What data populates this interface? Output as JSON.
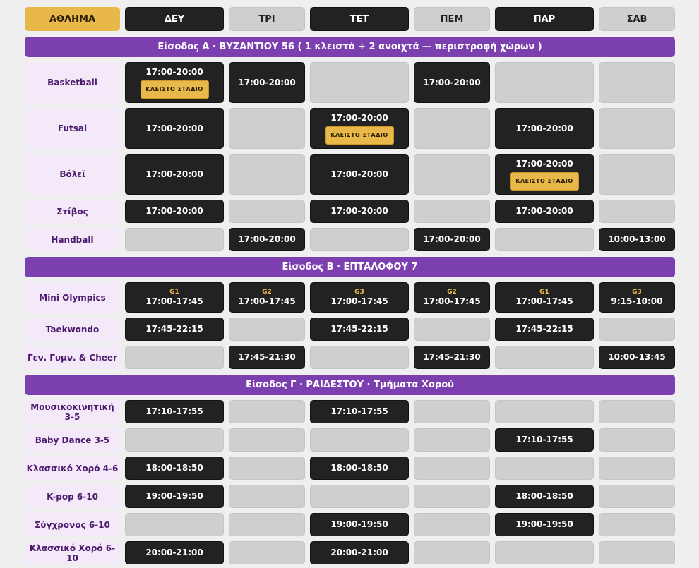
{
  "header": {
    "sport_label": "ΑΘΛΗΜΑ",
    "days": [
      "ΔΕΥ",
      "ΤΡΙ",
      "ΤΕΤ",
      "ΠΕΜ",
      "ΠΑΡ",
      "ΣΑΒ"
    ],
    "active_days": [
      0,
      2,
      4
    ]
  },
  "closed_label": "ΚΛΕΙΣΤΟ ΣΤΑΔΙΟ",
  "sections": [
    {
      "title": "Είσοδος Α · ΒΥΖΑΝΤΙΟΥ 56  ( 1 κλειστό + 2 ανοιχτά — περιστροφή χώρων )",
      "rows": [
        {
          "sport": "Basketball",
          "cells": [
            {
              "time": "17:00-20:00",
              "closed": true
            },
            {
              "time": "17:00-20:00"
            },
            null,
            {
              "time": "17:00-20:00"
            },
            null,
            null
          ]
        },
        {
          "sport": "Futsal",
          "cells": [
            {
              "time": "17:00-20:00"
            },
            null,
            {
              "time": "17:00-20:00",
              "closed": true
            },
            null,
            {
              "time": "17:00-20:00"
            },
            null
          ]
        },
        {
          "sport": "Βόλεϊ",
          "cells": [
            {
              "time": "17:00-20:00"
            },
            null,
            {
              "time": "17:00-20:00"
            },
            null,
            {
              "time": "17:00-20:00",
              "closed": true
            },
            null
          ]
        },
        {
          "sport": "Στίβος",
          "cells": [
            {
              "time": "17:00-20:00"
            },
            null,
            {
              "time": "17:00-20:00"
            },
            null,
            {
              "time": "17:00-20:00"
            },
            null
          ]
        },
        {
          "sport": "Handball",
          "cells": [
            null,
            {
              "time": "17:00-20:00"
            },
            null,
            {
              "time": "17:00-20:00"
            },
            null,
            {
              "time": "10:00-13:00"
            }
          ]
        }
      ]
    },
    {
      "title": "Είσοδος Β · ΕΠΤΑΛΟΦΟΥ 7",
      "rows": [
        {
          "sport": "Mini Olympics",
          "cells": [
            {
              "group": "G1",
              "time": "17:00-17:45"
            },
            {
              "group": "G2",
              "time": "17:00-17:45"
            },
            {
              "group": "G3",
              "time": "17:00-17:45"
            },
            {
              "group": "G2",
              "time": "17:00-17:45"
            },
            {
              "group": "G1",
              "time": "17:00-17:45"
            },
            {
              "group": "G3",
              "time": "9:15-10:00"
            }
          ]
        },
        {
          "sport": "Taekwondo",
          "cells": [
            {
              "time": "17:45-22:15"
            },
            null,
            {
              "time": "17:45-22:15"
            },
            null,
            {
              "time": "17:45-22:15"
            },
            null
          ]
        },
        {
          "sport": "Γεν. Γυμν. & Cheer",
          "cells": [
            null,
            {
              "time": "17:45-21:30"
            },
            null,
            {
              "time": "17:45-21:30"
            },
            null,
            {
              "time": "10:00-13:45"
            }
          ]
        }
      ]
    },
    {
      "title": "Είσοδος Γ · ΡΑΙΔΕΣΤΟΥ · Τμήματα Χορού",
      "rows": [
        {
          "sport": "Μουσικοκινητική 3-5",
          "cells": [
            {
              "time": "17:10-17:55"
            },
            null,
            {
              "time": "17:10-17:55"
            },
            null,
            null,
            null
          ]
        },
        {
          "sport": "Baby Dance 3-5",
          "cells": [
            null,
            null,
            null,
            null,
            {
              "time": "17:10-17:55"
            },
            null
          ]
        },
        {
          "sport": "Κλασσικό Χορό 4-6",
          "cells": [
            {
              "time": "18:00-18:50"
            },
            null,
            {
              "time": "18:00-18:50"
            },
            null,
            null,
            null
          ]
        },
        {
          "sport": "K-pop 6-10",
          "cells": [
            {
              "time": "19:00-19:50"
            },
            null,
            null,
            null,
            {
              "time": "18:00-18:50"
            },
            null
          ]
        },
        {
          "sport": "Σύγχρονος 6-10",
          "cells": [
            null,
            null,
            {
              "time": "19:00-19:50"
            },
            null,
            {
              "time": "19:00-19:50"
            },
            null
          ]
        },
        {
          "sport": "Κλασσικό Χορό 6-10",
          "cells": [
            {
              "time": "20:00-21:00"
            },
            null,
            {
              "time": "20:00-21:00"
            },
            null,
            null,
            null
          ]
        }
      ]
    }
  ]
}
